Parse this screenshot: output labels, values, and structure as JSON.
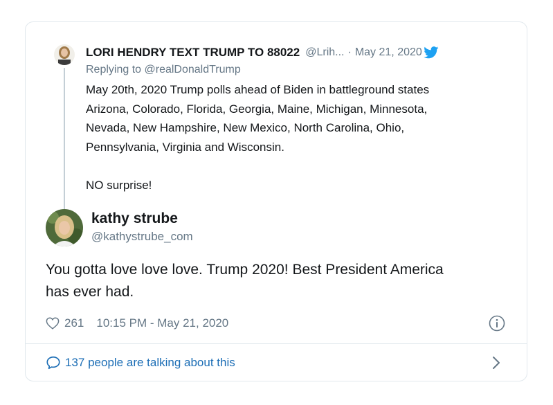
{
  "parent_tweet": {
    "author_name": "LORI HENDRY TEXT TRUMP TO 88022",
    "author_handle": "@Lrih...",
    "separator": "·",
    "date": "May 21, 2020",
    "replying_to": "Replying to @realDonaldTrump",
    "text_lines": [
      "May 20th, 2020 Trump polls ahead of Biden in battleground states",
      "Arizona, Colorado, Florida, Georgia, Maine, Michigan, Minnesota,",
      "Nevada, New Hampshire, New Mexico, North Carolina, Ohio,",
      "Pennsylvania, Virginia and Wisconsin."
    ],
    "text_closing": "NO surprise!"
  },
  "tweet": {
    "author_name": "kathy strube",
    "author_handle": "@kathystrube_com",
    "text_lines": [
      "You gotta love love love. Trump 2020! Best President America",
      "has ever had."
    ],
    "like_count": "261",
    "timestamp": "10:15 PM - May 21, 2020"
  },
  "footer": {
    "talking_label": "137 people are talking about this"
  },
  "icons": {
    "brand": "twitter-bird-icon",
    "like": "heart-icon",
    "info": "info-icon",
    "conversation": "speech-bubble-icon",
    "open": "chevron-right-icon"
  },
  "colors": {
    "brand_blue": "#1da1f2",
    "link_blue": "#1b6db5",
    "secondary_text": "#657786",
    "border": "#e1e8ed"
  }
}
